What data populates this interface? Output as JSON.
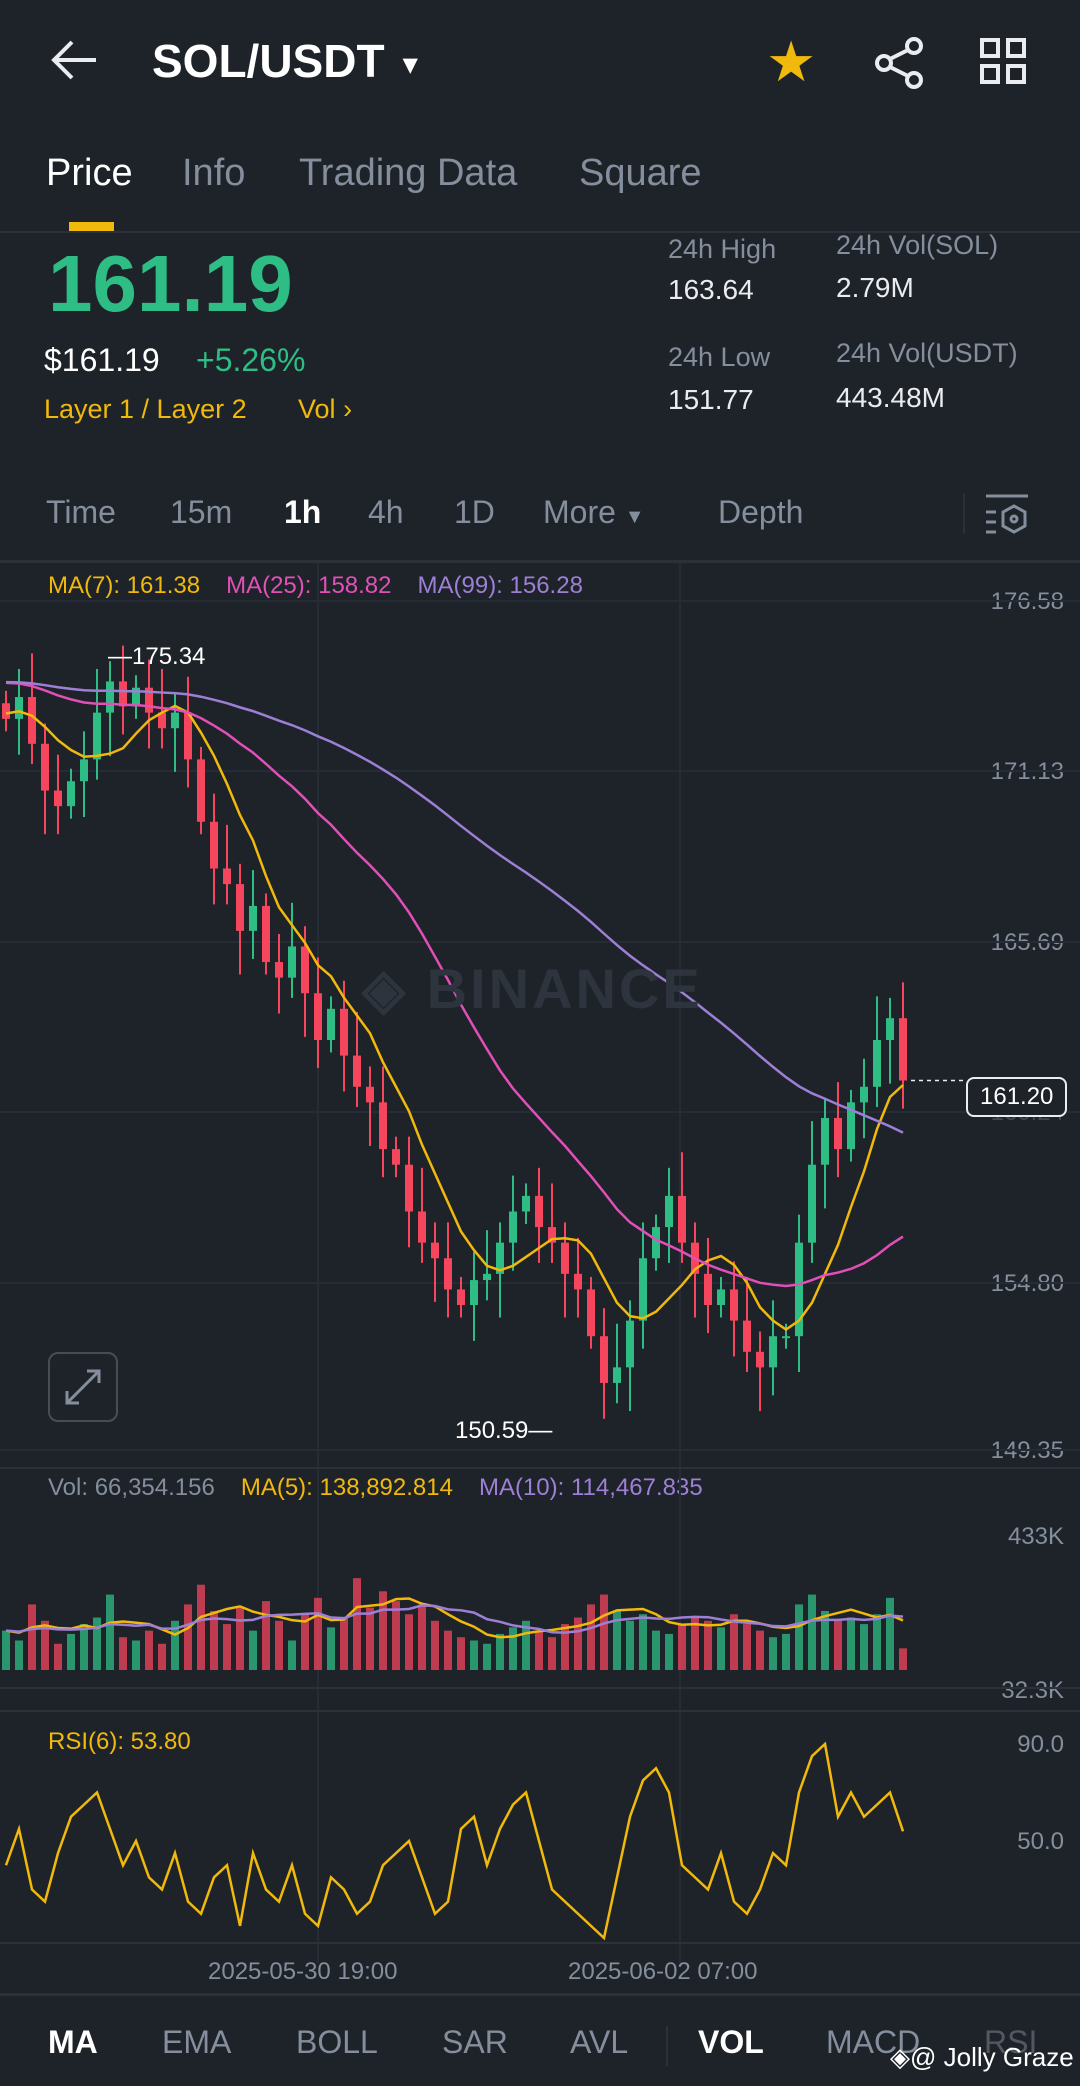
{
  "header": {
    "title": "SOL/USDT"
  },
  "tabs": [
    "Price",
    "Info",
    "Trading Data",
    "Square"
  ],
  "price": {
    "last": "161.19",
    "usd": "$161.19",
    "change": "+5.26%",
    "tag1": "Layer 1 / Layer 2",
    "tag2": "Vol"
  },
  "stats": {
    "high_label": "24h High",
    "high": "163.64",
    "low_label": "24h Low",
    "low": "151.77",
    "vol_sol_label": "24h Vol(SOL)",
    "vol_sol": "2.79M",
    "vol_usdt_label": "24h Vol(USDT)",
    "vol_usdt": "443.48M"
  },
  "timeframes": [
    "Time",
    "15m",
    "1h",
    "4h",
    "1D",
    "More",
    "Depth"
  ],
  "ma_legend": {
    "ma7": "MA(7): 161.38",
    "ma25": "MA(25): 158.82",
    "ma99": "MA(99): 156.28"
  },
  "vol_legend": {
    "vol": "Vol: 66,354.156",
    "ma5": "MA(5): 138,892.814",
    "ma10": "MA(10): 114,467.835"
  },
  "rsi_legend": "RSI(6): 53.80",
  "watermark": "BINANCE",
  "footer_watermark": "@ Jolly Graze",
  "indicators": [
    "MA",
    "EMA",
    "BOLL",
    "SAR",
    "AVL",
    "VOL",
    "MACD",
    "RSI"
  ],
  "colors": {
    "up": "#2ebd85",
    "down": "#f6465d",
    "ma7": "#f0b90b",
    "ma25": "#e24fb8",
    "ma99": "#9d7fd6",
    "accent": "#f0b90b"
  },
  "chart_data": {
    "type": "candlestick",
    "price_axis": [
      "176.58",
      "171.13",
      "165.69",
      "160.24",
      "154.80",
      "149.35"
    ],
    "ylim": [
      149.35,
      176.58
    ],
    "current_price": "161.20",
    "high_marker": "175.34",
    "low_marker": "150.59",
    "x_labels": [
      "2025-05-30 19:00",
      "2025-06-02 07:00"
    ],
    "vol_axis": [
      "433K",
      "32.3K"
    ],
    "vol_max": 433,
    "rsi_axis": [
      "90.0",
      "50.0"
    ],
    "closes": [
      172.8,
      173.5,
      172.0,
      170.5,
      170.0,
      170.8,
      171.5,
      173.0,
      174.0,
      173.2,
      173.8,
      173.0,
      172.5,
      173.0,
      171.5,
      169.5,
      168.0,
      167.5,
      166.0,
      166.8,
      165.0,
      164.5,
      165.5,
      164.0,
      162.5,
      163.5,
      162.0,
      161.0,
      160.5,
      159.0,
      158.5,
      157.0,
      156.0,
      155.5,
      154.5,
      154.0,
      154.8,
      155.0,
      156.0,
      157.0,
      157.5,
      156.5,
      156.0,
      155.0,
      154.5,
      153.0,
      151.5,
      152.0,
      153.5,
      155.5,
      156.5,
      157.5,
      156.0,
      155.0,
      154.0,
      154.5,
      153.5,
      152.5,
      152.0,
      153.0,
      153.0,
      156.0,
      158.5,
      160.0,
      159.0,
      160.5,
      161.0,
      162.5,
      163.2,
      161.2
    ],
    "volumes": [
      120,
      90,
      200,
      150,
      80,
      110,
      140,
      160,
      230,
      100,
      90,
      120,
      80,
      150,
      200,
      260,
      180,
      140,
      190,
      120,
      210,
      150,
      90,
      170,
      220,
      130,
      160,
      280,
      190,
      240,
      210,
      170,
      200,
      150,
      120,
      100,
      90,
      80,
      110,
      130,
      150,
      120,
      100,
      140,
      160,
      200,
      230,
      180,
      150,
      170,
      120,
      110,
      140,
      160,
      150,
      130,
      170,
      140,
      120,
      100,
      110,
      200,
      230,
      180,
      150,
      160,
      140,
      170,
      220,
      66
    ],
    "rsi": [
      40,
      55,
      30,
      25,
      45,
      60,
      65,
      70,
      55,
      40,
      50,
      35,
      30,
      45,
      25,
      20,
      35,
      40,
      15,
      45,
      30,
      25,
      40,
      20,
      15,
      35,
      30,
      20,
      25,
      40,
      45,
      50,
      35,
      20,
      25,
      55,
      60,
      40,
      55,
      65,
      70,
      50,
      30,
      25,
      20,
      15,
      10,
      35,
      60,
      75,
      80,
      70,
      40,
      35,
      30,
      45,
      25,
      20,
      30,
      45,
      40,
      70,
      85,
      90,
      60,
      70,
      60,
      65,
      70,
      54
    ]
  }
}
